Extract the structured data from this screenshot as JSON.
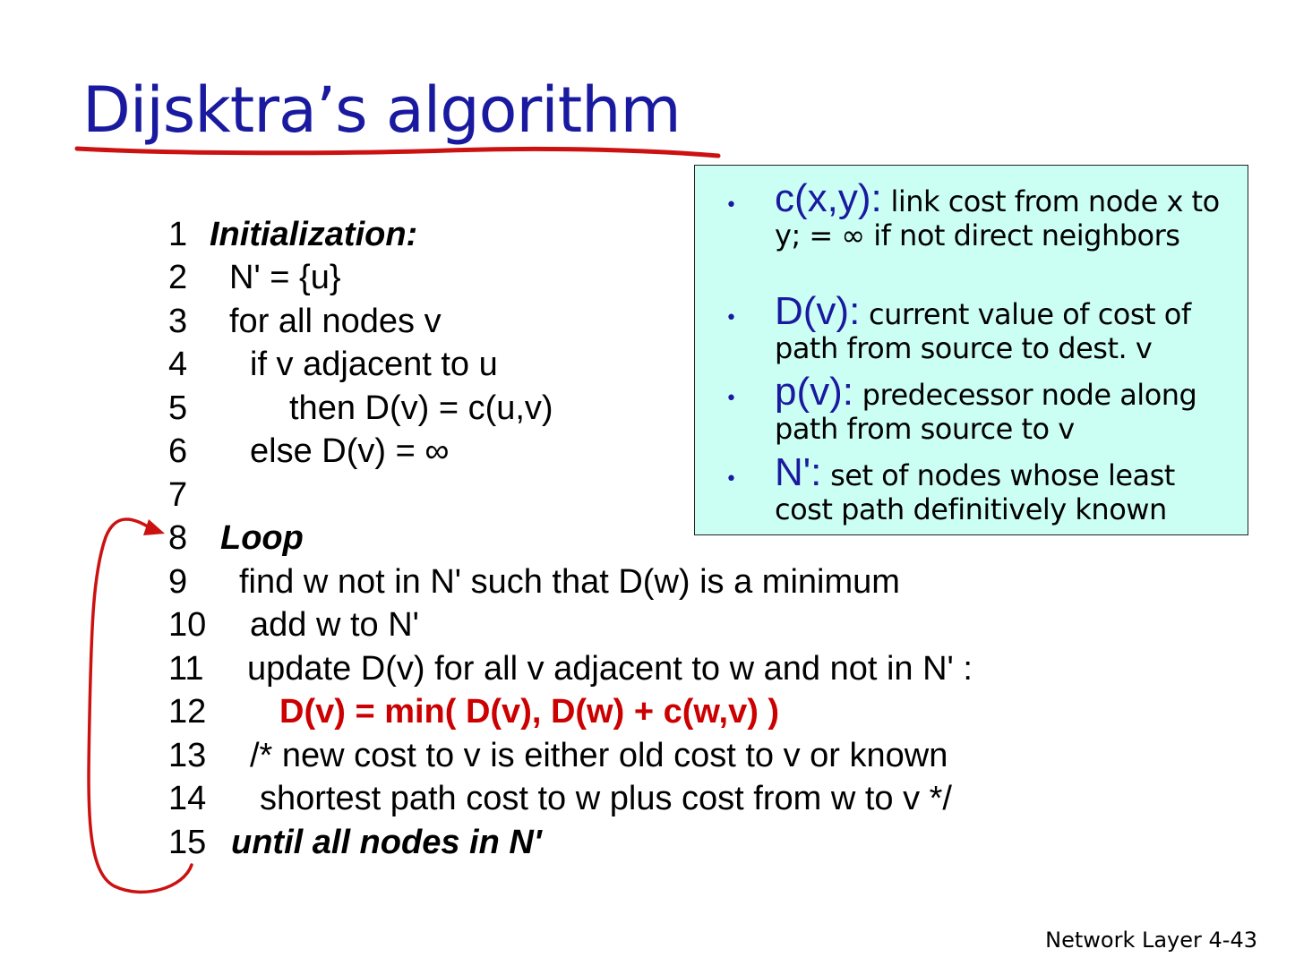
{
  "title": "Dijsktra’s algorithm",
  "definitions": [
    {
      "term": "c(x,y):",
      "text": " link cost from node x to y;  = ∞ if not direct neighbors"
    },
    {
      "term": "D(v):",
      "text": " current value of cost of path from source to dest. v"
    },
    {
      "term": "p(v):",
      "text": " predecessor node along path from source to v"
    },
    {
      "term": "N':",
      "text": " set of nodes whose least cost path definitively known"
    }
  ],
  "code_lines": [
    {
      "num": "1",
      "text": "Initialization:"
    },
    {
      "num": "2",
      "text": "N' = {u}"
    },
    {
      "num": "3",
      "text": "for all nodes v"
    },
    {
      "num": "4",
      "text": "if v adjacent to u"
    },
    {
      "num": "5",
      "text": "then D(v) = c(u,v)"
    },
    {
      "num": "6",
      "text": "else D(v) = ∞"
    },
    {
      "num": "7",
      "text": ""
    },
    {
      "num": "8",
      "text": "Loop"
    },
    {
      "num": "9",
      "text": "find w not in N' such that D(w) is a minimum"
    },
    {
      "num": "10",
      "text": "add w to N'"
    },
    {
      "num": "11",
      "text": "update D(v) for all v adjacent to w and not in N' :"
    },
    {
      "num": "12",
      "text": "D(v) = min( D(v), D(w) + c(w,v) )"
    },
    {
      "num": "13",
      "text": "/* new cost to v is either old cost to v or known"
    },
    {
      "num": "14",
      "text": "shortest path cost to w plus cost from w to v */"
    },
    {
      "num": "15",
      "text": "until all nodes in N'"
    }
  ],
  "footer": "Network Layer  4-43",
  "colors": {
    "title": "#1a1aa0",
    "box_bg": "#ccfff4",
    "highlight": "#cc0000"
  }
}
